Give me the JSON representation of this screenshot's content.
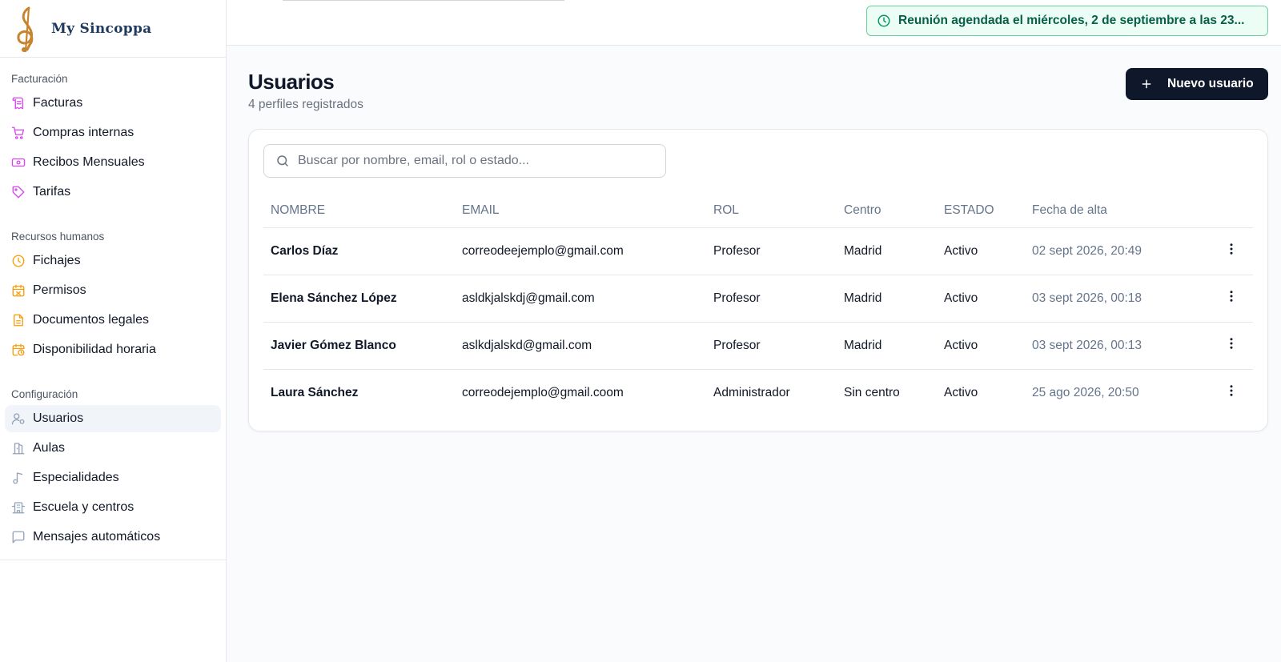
{
  "brand": {
    "name": "My Sincoppa"
  },
  "colors": {
    "accent": "#0f172a",
    "toast_bg": "#ecfdf5",
    "toast_text": "#065f46",
    "icon_pink": "#d946ef",
    "icon_amber": "#f59e0b",
    "icon_slate": "#94a3b8"
  },
  "sidebar": {
    "sections": [
      {
        "title": "Facturación",
        "items": [
          {
            "label": "Facturas",
            "icon": "receipt-icon"
          },
          {
            "label": "Compras internas",
            "icon": "cart-icon"
          },
          {
            "label": "Recibos Mensuales",
            "icon": "banknote-icon"
          },
          {
            "label": "Tarifas",
            "icon": "tag-icon"
          }
        ]
      },
      {
        "title": "Recursos humanos",
        "items": [
          {
            "label": "Fichajes",
            "icon": "clock-icon"
          },
          {
            "label": "Permisos",
            "icon": "calendar-off-icon"
          },
          {
            "label": "Documentos legales",
            "icon": "document-icon"
          },
          {
            "label": "Disponibilidad horaria",
            "icon": "calendar-clock-icon"
          }
        ]
      },
      {
        "title": "Configuración",
        "items": [
          {
            "label": "Usuarios",
            "icon": "user-cog-icon",
            "active": true
          },
          {
            "label": "Aulas",
            "icon": "door-icon"
          },
          {
            "label": "Especialidades",
            "icon": "music-note-icon"
          },
          {
            "label": "Escuela y centros",
            "icon": "building-icon"
          },
          {
            "label": "Mensajes automáticos",
            "icon": "message-icon"
          }
        ]
      }
    ]
  },
  "toast": {
    "text": "Reunión agendada el miércoles, 2 de septiembre a las 23...",
    "icon": "clock-icon"
  },
  "page": {
    "title": "Usuarios",
    "subtitle": "4 perfiles registrados",
    "new_button_label": "Nuevo usuario"
  },
  "search": {
    "placeholder": "Buscar por nombre, email, rol o estado...",
    "value": ""
  },
  "table": {
    "headers": [
      "NOMBRE",
      "EMAIL",
      "ROL",
      "Centro",
      "ESTADO",
      "Fecha de alta"
    ],
    "rows": [
      [
        "Carlos Díaz",
        "correodeejemplo@gmail.com",
        "Profesor",
        "Madrid",
        "Activo",
        "02 sept 2026, 20:49"
      ],
      [
        "Elena Sánchez López",
        "asldkjalskdj@gmail.com",
        "Profesor",
        "Madrid",
        "Activo",
        "03 sept 2026, 00:18"
      ],
      [
        "Javier Gómez Blanco",
        "aslkdjalskd@gmail.com",
        "Profesor",
        "Madrid",
        "Activo",
        "03 sept 2026, 00:13"
      ],
      [
        "Laura Sánchez",
        "correodejemplo@gmail.coom",
        "Administrador",
        "Sin centro",
        "Activo",
        "25 ago 2026, 20:50"
      ]
    ]
  }
}
